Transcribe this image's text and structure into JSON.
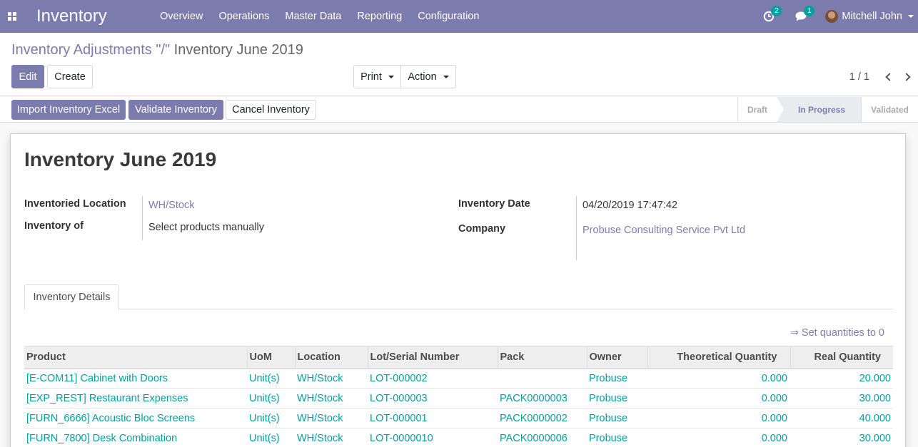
{
  "app": {
    "title": "Inventory",
    "menu": [
      "Overview",
      "Operations",
      "Master Data",
      "Reporting",
      "Configuration"
    ],
    "activity_count": "2",
    "message_count": "1",
    "user_name": "Mitchell John"
  },
  "breadcrumb": {
    "parent": "Inventory Adjustments",
    "separator": " \"/\" ",
    "current": "Inventory June 2019"
  },
  "toolbar": {
    "edit": "Edit",
    "create": "Create",
    "print": "Print",
    "action": "Action"
  },
  "pager": {
    "value": "1 / 1"
  },
  "statusbar": {
    "buttons": [
      "Import Inventory Excel",
      "Validate Inventory",
      "Cancel Inventory"
    ],
    "stages": [
      "Draft",
      "In Progress",
      "Validated"
    ],
    "active_stage": "In Progress"
  },
  "record": {
    "title": "Inventory June 2019",
    "fields": {
      "location_label": "Inventoried Location",
      "location_value": "WH/Stock",
      "inventory_of_label": "Inventory of",
      "inventory_of_value": "Select products manually",
      "date_label": "Inventory Date",
      "date_value": "04/20/2019 17:47:42",
      "company_label": "Company",
      "company_value": "Probuse Consulting Service Pvt Ltd"
    }
  },
  "tabs": [
    "Inventory Details"
  ],
  "set_quantities": "⇒ Set quantities to 0",
  "table": {
    "columns": [
      "Product",
      "UoM",
      "Location",
      "Lot/Serial Number",
      "Pack",
      "Owner",
      "Theoretical Quantity",
      "Real Quantity"
    ],
    "rows": [
      [
        "[E-COM11] Cabinet with Doors",
        "Unit(s)",
        "WH/Stock",
        "LOT-000002",
        "",
        "Probuse",
        "0.000",
        "20.000"
      ],
      [
        "[EXP_REST] Restaurant Expenses",
        "Unit(s)",
        "WH/Stock",
        "LOT-000003",
        "PACK0000003",
        "Probuse",
        "0.000",
        "30.000"
      ],
      [
        "[FURN_6666] Acoustic Bloc Screens",
        "Unit(s)",
        "WH/Stock",
        "LOT-000001",
        "PACK0000002",
        "Probuse",
        "0.000",
        "40.000"
      ],
      [
        "[FURN_7800] Desk Combination",
        "Unit(s)",
        "WH/Stock",
        "LOT-0000010",
        "PACK0000006",
        "Probuse",
        "0.000",
        "30.000"
      ]
    ]
  },
  "colors": {
    "brand": "#7c7bad",
    "link_teal": "#00a09d"
  },
  "icons": {
    "apps": "apps-grid-icon",
    "activity": "clock-icon",
    "messages": "chat-icon",
    "user": "avatar"
  }
}
